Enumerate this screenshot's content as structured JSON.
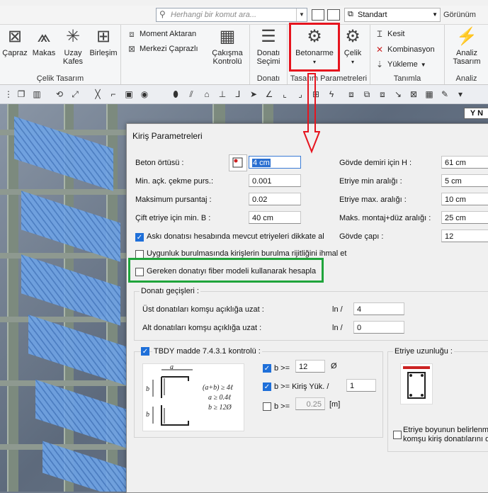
{
  "top": {
    "search_placeholder": "Herhangi bir komut ara...",
    "preset": "Standart",
    "view_label": "Görünüm"
  },
  "ribbon": {
    "groups": [
      {
        "name": "Çelik Tasarım",
        "buttons": [
          "Çapraz",
          "Makas",
          "Uzay Kafes",
          "Birleşim"
        ]
      },
      {
        "name": "",
        "small": [
          "Moment Aktaran",
          "Merkezi Çaprazlı"
        ],
        "big": "Çakışma Kontrolü"
      },
      {
        "name": "Donatı",
        "big": "Donatı Seçimi"
      },
      {
        "name": "Tasarım Parametreleri",
        "buttons": [
          "Betonarme",
          "Çelik"
        ]
      },
      {
        "name": "Tanımla",
        "small": [
          "Kesit",
          "Kombinasyon",
          "Yükleme"
        ]
      },
      {
        "name": "Analiz",
        "big": "Analiz Tasarım"
      }
    ],
    "labels": {
      "capraz": "Çapraz",
      "makas": "Makas",
      "uzay": "Uzay Kafes",
      "birlesim": "Birleşim",
      "celik_tasarim": "Çelik Tasarım",
      "moment": "Moment Aktaran",
      "merkezi": "Merkezi Çaprazlı",
      "cakisma": "Çakışma Kontrolü",
      "donati_secimi": "Donatı Seçimi",
      "donati": "Donatı",
      "betonarme": "Betonarme",
      "celik": "Çelik",
      "tasarim_param": "Tasarım Parametreleri",
      "kesit": "Kesit",
      "kombinasyon": "Kombinasyon",
      "yukleme": "Yükleme",
      "tanimla": "Tanımla",
      "analiz_tasarim": "Analiz Tasarım",
      "analiz": "Analiz"
    }
  },
  "scene": {
    "view_box": "Y N"
  },
  "dialog": {
    "title": "Kiriş Parametreleri",
    "left": {
      "beton_ortusu_label": "Beton örtüsü :",
      "beton_ortusu_value": "4 cm",
      "min_ack_label": "Min. açk. çekme purs.:",
      "min_ack_value": "0.001",
      "max_purs_label": "Maksimum pursantaj :",
      "max_purs_value": "0.02",
      "cift_etriye_label": "Çift etriye için min. B :",
      "cift_etriye_value": "40 cm"
    },
    "right": {
      "govde_demiri_label": "Gövde demiri için H :",
      "govde_demiri_value": "61 cm",
      "etriye_min_label": "Etriye min aralığı :",
      "etriye_min_value": "5 cm",
      "etriye_max_label": "Etriye max. aralığı :",
      "etriye_max_value": "10 cm",
      "maks_montaj_label": "Maks. montaj+düz aralığı :",
      "maks_montaj_value": "25 cm",
      "govde_capi_label": "Gövde çapı :",
      "govde_capi_value": "12"
    },
    "checkboxes": {
      "aski": "Askı donatısı hesabında mevcut etriyeleri dikkate al",
      "aski_checked": true,
      "uygunluk": "Uygunluk burulmasında kirişlerin burulma rijitliğini ihmal et",
      "uygunluk_checked": false,
      "fiber": "Gereken donatıyı fiber modeli kullanarak hesapla",
      "fiber_checked": false
    },
    "gecisler": {
      "title": "Donatı geçişleri :",
      "ust_label": "Üst donatıları komşu açıklığa uzat :",
      "alt_label": "Alt donatıları komşu açıklığa uzat :",
      "ln_label": "ln /",
      "ust_value": "4",
      "alt_value": "0"
    },
    "tbdy": {
      "title": "TBDY madde 7.4.3.1 kontrolü :",
      "checked": true,
      "b1_label": "b >=",
      "b1_value": "12",
      "b1_unit": "Ø",
      "b1_checked": true,
      "b2_label": "b >= Kiriş Yük. /",
      "b2_value": "1",
      "b2_checked": true,
      "b3_label": "b >=",
      "b3_value": "0.25",
      "b3_unit": "[m]",
      "b3_checked": false,
      "sketch": {
        "a": "a",
        "b": "b",
        "f1": "(a+b) ≥ 4ℓ",
        "f2": "a ≥ 0.4ℓ",
        "f3": "b ≥ 12Ø"
      }
    },
    "etriye": {
      "title": "Etriye uzunluğu :",
      "cb_text_1": "Etriye boyunun belirlenme",
      "cb_text_2": "komşu kiriş donatılarını dik",
      "checked": false
    }
  },
  "colors": {
    "red_annotation": "#e6141e",
    "green_annotation": "#1fa43b",
    "checkbox_blue": "#1e6fd9"
  }
}
